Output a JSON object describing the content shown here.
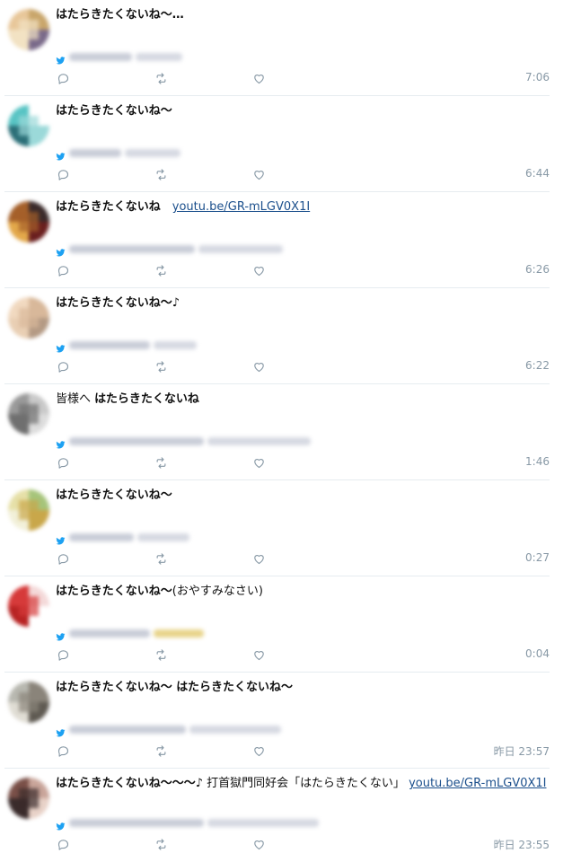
{
  "colors": {
    "link": "#1b4f8c",
    "muted": "#8899a6",
    "bird": "#1da1f2",
    "divider": "#e6ecf0"
  },
  "icons": [
    "twitter-bird-icon",
    "reply-icon",
    "retweet-icon",
    "like-icon"
  ],
  "tweets": [
    {
      "parts": [
        {
          "b": "はたらきたくないね〜…"
        }
      ],
      "time": "7:06",
      "av": [
        "#e8c79a",
        "#c9a66b",
        "#f2e2c3",
        "#7a6a8a"
      ]
    },
    {
      "parts": [
        {
          "b": "はたらきたくないね〜"
        }
      ],
      "time": "6:44",
      "av": [
        "#58c4c4",
        "#ffffff",
        "#2b6f78",
        "#9bd9d9"
      ]
    },
    {
      "parts": [
        {
          "b": "はたらきたくないね"
        },
        {
          "t": "　"
        },
        {
          "a": "youtu.be/GR-mLGV0X1I"
        }
      ],
      "time": "6:26",
      "av": [
        "#a5602a",
        "#3a2a2a",
        "#e3a84a",
        "#6a1f1f"
      ]
    },
    {
      "parts": [
        {
          "b": "はたらきたくないね〜♪"
        }
      ],
      "time": "6:22",
      "av": [
        "#f1d9c0",
        "#d8b89a",
        "#e9cfb4",
        "#b49a84"
      ]
    },
    {
      "parts": [
        {
          "p": "皆様へ "
        },
        {
          "b": "はたらきたくないね"
        }
      ],
      "time": "1:46",
      "av": [
        "#9a9a9a",
        "#c9c9c9",
        "#6f6f6f",
        "#dddddd"
      ]
    },
    {
      "parts": [
        {
          "b": "はたらきたくないね〜"
        }
      ],
      "time": "0:27",
      "av": [
        "#e6e0a8",
        "#a6c47a",
        "#f2f0d9",
        "#c9a74a"
      ]
    },
    {
      "parts": [
        {
          "b": "はたらきたくないね〜"
        },
        {
          "p": "(おやすみなさい)"
        }
      ],
      "time": "0:04",
      "av": [
        "#d63a3a",
        "#f4d9d9",
        "#b82323",
        "#ffffff"
      ]
    },
    {
      "parts": [
        {
          "b": "はたらきたくないね〜 はたらきたくないね〜"
        }
      ],
      "time": "昨日 23:57",
      "av": [
        "#b8b8b0",
        "#8a847a",
        "#e0ddd4",
        "#5f5a52"
      ]
    },
    {
      "parts": [
        {
          "b": "はたらきたくないね〜〜〜♪"
        },
        {
          "p": " 打首獄門同好会「はたらきたくない」 "
        },
        {
          "a": "youtu.be/GR-mLGV0X1I"
        }
      ],
      "time": "昨日 23:55",
      "av": [
        "#7a5048",
        "#c9a59a",
        "#3a2b2b",
        "#e8d2c8"
      ]
    }
  ]
}
